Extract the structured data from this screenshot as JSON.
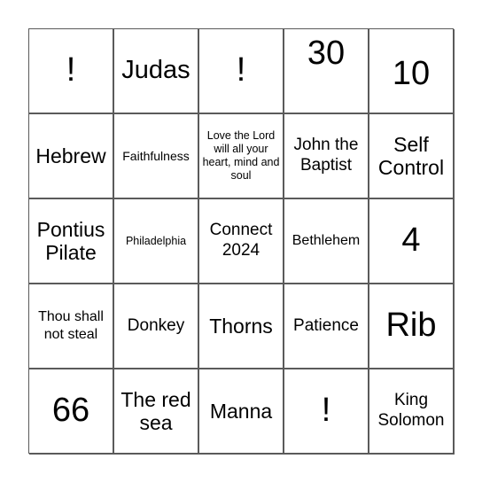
{
  "card": {
    "border_color": "#5a5a5a",
    "cells": [
      [
        "!",
        "Judas",
        "!",
        "30",
        "10"
      ],
      [
        "Hebrew",
        "Faithfulness",
        "Love the Lord will all your heart, mind and soul",
        "John the Baptist",
        "Self Control"
      ],
      [
        "Pontius Pilate",
        "Philadelphia",
        "Connect 2024",
        "Bethlehem",
        "4"
      ],
      [
        "Thou shall not steal",
        "Donkey",
        "Thorns",
        "Patience",
        "Rib"
      ],
      [
        "66",
        "The red sea",
        "Manna",
        "!",
        "King Solomon"
      ]
    ]
  }
}
